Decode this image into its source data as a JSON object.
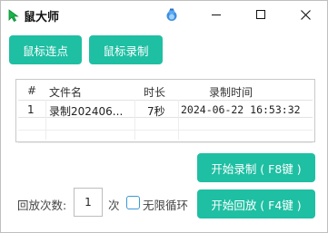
{
  "window": {
    "title": "鼠大师",
    "accent_color": "#1fbfa3",
    "icons": {
      "app": "green-cursor-icon",
      "mascot": "blue-mascot-icon"
    }
  },
  "toolbar": {
    "click_label": "鼠标连点",
    "macro_label": "鼠标录制"
  },
  "table": {
    "headers": {
      "num": "#",
      "name": "文件名",
      "duration": "时长",
      "time": "录制时间"
    },
    "rows": [
      {
        "num": "1",
        "name": "录制202406...",
        "duration": "7秒",
        "time": "2024-06-22 16:53:32"
      }
    ]
  },
  "controls": {
    "record_label": "开始录制 ( F8键 )",
    "play_label": "开始回放 ( F4键 )",
    "count_label": "回放次数:",
    "count_value": "1",
    "count_unit": "次",
    "loop_label": "无限循环",
    "loop_checked": false
  }
}
